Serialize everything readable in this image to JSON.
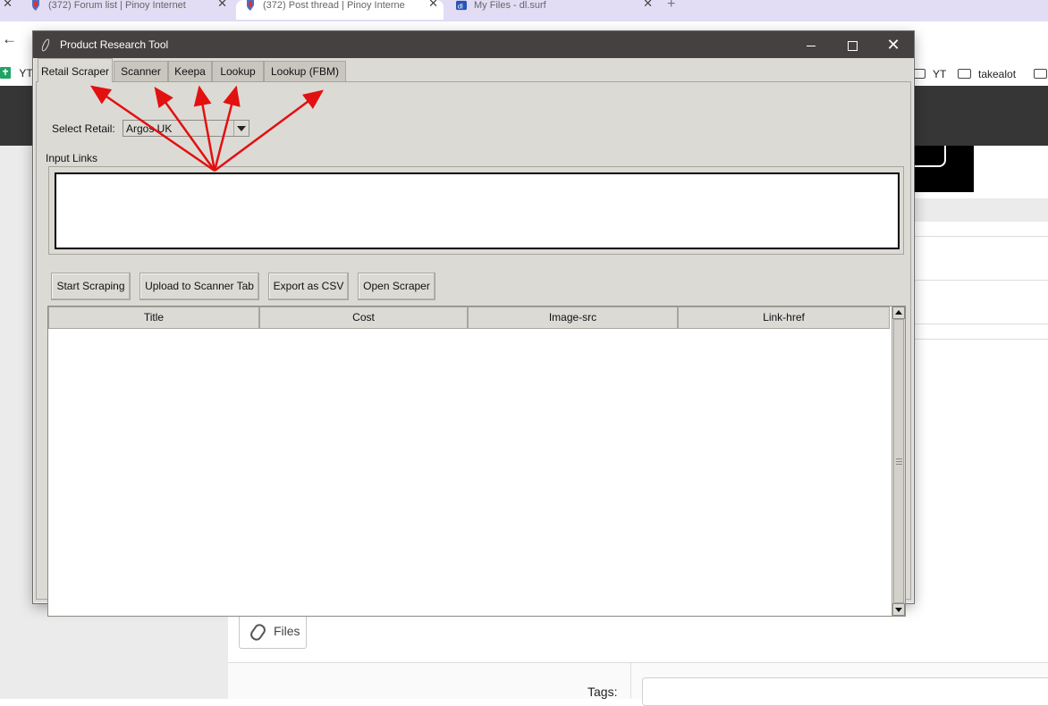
{
  "browser": {
    "tabs": [
      {
        "title": "(372) Forum list | Pinoy Internet"
      },
      {
        "title": "(372) Post thread | Pinoy Interne"
      },
      {
        "title": "My Files - dl.surf"
      }
    ],
    "bookmarks": {
      "left_label": "YT",
      "right_items": [
        "YT",
        "takealot"
      ]
    }
  },
  "page": {
    "files_label": "Files",
    "tags_label": "Tags:"
  },
  "app": {
    "title": "Product Research Tool",
    "tabs": [
      "Retail Scraper",
      "Scanner",
      "Keepa",
      "Lookup",
      "Lookup (FBM)"
    ],
    "active_tab": "Retail Scraper",
    "select_retail_label": "Select Retail:",
    "selected_retail": "Argos UK",
    "input_links_label": "Input Links",
    "input_links_value": "",
    "buttons": {
      "start": "Start Scraping",
      "upload": "Upload to Scanner Tab",
      "export": "Export as CSV",
      "open": "Open Scraper"
    },
    "table_columns": [
      "Title",
      "Cost",
      "Image-src",
      "Link-href"
    ],
    "table_rows": []
  },
  "annotation": {
    "arrow_color": "#e31010"
  }
}
